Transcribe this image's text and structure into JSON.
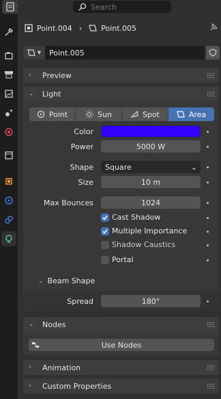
{
  "search": {
    "placeholder": "Search"
  },
  "breadcrumb": {
    "object": "Point.004",
    "data": "Point.005"
  },
  "datablock": {
    "name": "Point.005"
  },
  "panels": {
    "preview": "Preview",
    "light": "Light",
    "nodes": "Nodes",
    "animation": "Animation",
    "custom_properties": "Custom Properties"
  },
  "light": {
    "types": [
      {
        "label": "Point",
        "icon": "point-light-icon",
        "active": false
      },
      {
        "label": "Sun",
        "icon": "sun-light-icon",
        "active": false
      },
      {
        "label": "Spot",
        "icon": "spot-light-icon",
        "active": false
      },
      {
        "label": "Area",
        "icon": "area-light-icon",
        "active": true
      }
    ],
    "color_label": "Color",
    "color_value": "#3300ff",
    "power_label": "Power",
    "power_value": "5000 W",
    "shape_label": "Shape",
    "shape_value": "Square",
    "size_label": "Size",
    "size_value": "10 m",
    "max_bounces_label": "Max Bounces",
    "max_bounces_value": "1024",
    "cast_shadow": {
      "label": "Cast Shadow",
      "checked": true
    },
    "multiple_importance": {
      "label": "Multiple Importance",
      "checked": true
    },
    "shadow_caustics": {
      "label": "Shadow Caustics",
      "checked": false
    },
    "portal": {
      "label": "Portal",
      "checked": false
    },
    "beam_shape": {
      "title": "Beam Shape",
      "spread_label": "Spread",
      "spread_value": "180°"
    }
  },
  "nodes": {
    "use_nodes_label": "Use Nodes"
  },
  "colors": {
    "accent": "#4772b3",
    "panel": "#3d3d3d",
    "field": "#545454",
    "background": "#303030"
  }
}
